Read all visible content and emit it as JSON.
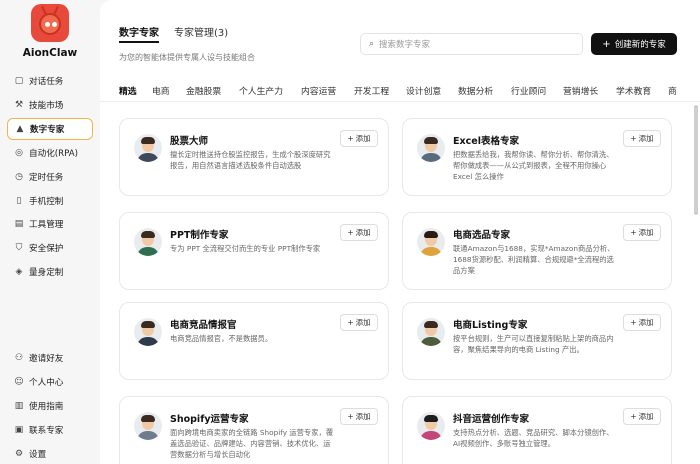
{
  "app": {
    "name": "AionClaw"
  },
  "sidebar": {
    "items": [
      {
        "label": "对话任务",
        "icon": "chat-icon"
      },
      {
        "label": "技能市场",
        "icon": "wrench-icon"
      },
      {
        "label": "数字专家",
        "icon": "graduation-cap-icon",
        "active": true
      },
      {
        "label": "自动化(RPA)",
        "icon": "automation-icon"
      },
      {
        "label": "定时任务",
        "icon": "clock-icon"
      },
      {
        "label": "手机控制",
        "icon": "phone-icon"
      },
      {
        "label": "工具管理",
        "icon": "toolbox-icon"
      },
      {
        "label": "安全保护",
        "icon": "shield-icon"
      },
      {
        "label": "量身定制",
        "icon": "badge-icon"
      }
    ],
    "bottom_items": [
      {
        "label": "邀请好友",
        "icon": "invite-icon"
      },
      {
        "label": "个人中心",
        "icon": "user-icon"
      },
      {
        "label": "使用指南",
        "icon": "book-icon"
      },
      {
        "label": "联系专家",
        "icon": "briefcase-icon"
      },
      {
        "label": "设置",
        "icon": "gear-icon"
      }
    ]
  },
  "header": {
    "tabs": [
      "数字专家",
      "专家管理(3)"
    ],
    "subtitle": "为您的智能体提供专属人设与技能组合",
    "search_placeholder": "搜索数字专家",
    "create_label": "创建新的专家"
  },
  "categories": [
    "精选",
    "电商",
    "金融股票",
    "个人生产力",
    "内容运营",
    "开发工程",
    "设计创意",
    "数据分析",
    "行业顾问",
    "营销增长",
    "学术教育",
    "商"
  ],
  "add_label": "添加",
  "experts": [
    {
      "title": "股票大师",
      "desc": "擅长定时推送持仓股监控报告，生成个股深度研究报告，用自然语言描述选股条件自动选股"
    },
    {
      "title": "Excel表格专家",
      "desc": "把数据丢给我，我帮你读、帮你分析、帮你清洗、帮你做成表——从公式到报表，全程不用你操心 Excel 怎么操作"
    },
    {
      "title": "PPT制作专家",
      "desc": "专为 PPT 全流程交付而生的专业 PPT制作专家"
    },
    {
      "title": "电商选品专家",
      "desc": "联通Amazon与1688，实现*Amazon商品分析、1688货源秒配、利润精算、合规规避*全流程的选品方案"
    },
    {
      "title": "电商竞品情报官",
      "desc": "电商竞品情报官，不是数据员。"
    },
    {
      "title": "电商Listing专家",
      "desc": "按平台规则，生产可以直接复制粘贴上架的商品内容，聚焦结果导向的电商 Listing 产出。"
    },
    {
      "title": "Shopify运营专家",
      "desc": "面向跨境电商卖家的全链路 Shopify 运营专家，覆盖选品验证、品牌建站、内容营销、技术优化、运营数据分析与增长自动化"
    },
    {
      "title": "抖音运营创作专家",
      "desc": "支持热点分析、选题、竞品研究、脚本分镜创作、AI视频创作、多账号独立管理。"
    }
  ]
}
